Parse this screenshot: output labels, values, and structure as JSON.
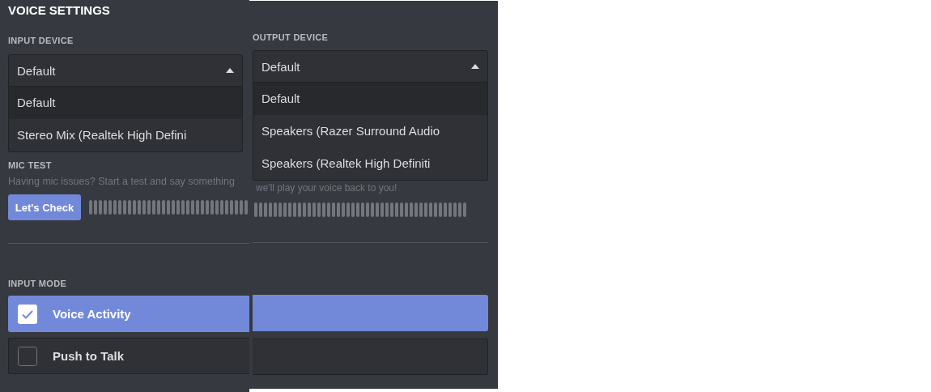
{
  "title": "VOICE SETTINGS",
  "input_device": {
    "label": "INPUT DEVICE",
    "value": "Default",
    "expanded": true,
    "options": [
      {
        "label": "Default",
        "selected": true
      },
      {
        "label": "Stereo Mix (Realtek High Defini",
        "selected": false
      }
    ]
  },
  "output_device": {
    "label": "OUTPUT DEVICE",
    "value": "Default",
    "expanded": true,
    "options": [
      {
        "label": "Default",
        "selected": true
      },
      {
        "label": "Speakers (Razer Surround Audio",
        "selected": false
      },
      {
        "label": "Speakers (Realtek High Definiti",
        "selected": false
      }
    ]
  },
  "mic_test": {
    "label": "MIC TEST",
    "description_left": "Having mic issues? Start a test and say something",
    "description_right": "we'll play your voice back to you!",
    "button": "Let's Check"
  },
  "input_mode": {
    "label": "INPUT MODE",
    "options": [
      {
        "label": "Voice Activity",
        "selected": true
      },
      {
        "label": "Push to Talk",
        "selected": false
      }
    ]
  }
}
